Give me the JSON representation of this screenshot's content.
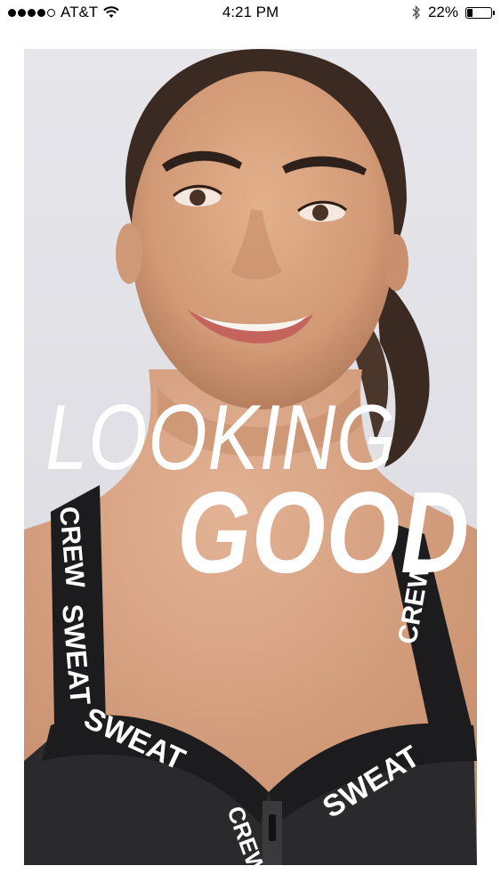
{
  "status_bar": {
    "carrier": "AT&T",
    "time": "4:21 PM",
    "battery_percent": "22%",
    "battery_level": 0.22,
    "signal_bars_filled": 4,
    "signal_bars_total": 5,
    "icons": [
      "signal-dots-icon",
      "wifi-icon",
      "bluetooth-icon",
      "battery-icon"
    ]
  },
  "hero": {
    "line1": "LOOKING",
    "line2": "GOOD",
    "strap_text_1": "CREW",
    "strap_text_2": "SWEAT",
    "strap_text_3": "SWEAT",
    "strap_text_4": "SWEAT",
    "strap_text_5": "CREW",
    "strap_text_6": "CREW"
  },
  "colors": {
    "background": "#ffffff",
    "headline": "#ffffff",
    "strap": "#1c1c1f"
  }
}
